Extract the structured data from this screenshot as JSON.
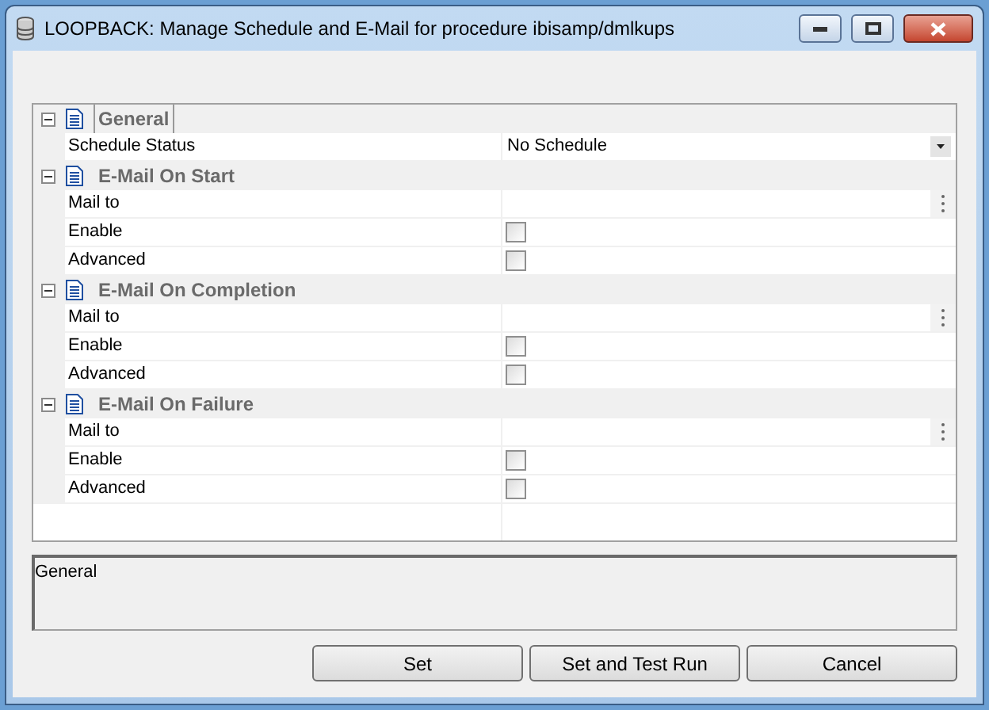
{
  "window": {
    "title": "LOOPBACK: Manage Schedule and E-Mail for procedure ibisamp/dmlkups"
  },
  "sections": [
    {
      "title": "General",
      "expanded": true,
      "selected": true,
      "rows": [
        {
          "kind": "dropdown",
          "label": "Schedule Status",
          "value": "No Schedule"
        }
      ]
    },
    {
      "title": "E-Mail On Start",
      "expanded": true,
      "selected": false,
      "rows": [
        {
          "kind": "ellipsis",
          "label": "Mail to"
        },
        {
          "kind": "checkbox",
          "label": "Enable",
          "checked": false
        },
        {
          "kind": "checkbox",
          "label": "Advanced",
          "checked": false
        }
      ]
    },
    {
      "title": "E-Mail On Completion",
      "expanded": true,
      "selected": false,
      "rows": [
        {
          "kind": "ellipsis",
          "label": "Mail to"
        },
        {
          "kind": "checkbox",
          "label": "Enable",
          "checked": false
        },
        {
          "kind": "checkbox",
          "label": "Advanced",
          "checked": false
        }
      ]
    },
    {
      "title": "E-Mail On Failure",
      "expanded": true,
      "selected": false,
      "rows": [
        {
          "kind": "ellipsis",
          "label": "Mail to"
        },
        {
          "kind": "checkbox",
          "label": "Enable",
          "checked": false
        },
        {
          "kind": "checkbox",
          "label": "Advanced",
          "checked": false
        }
      ]
    }
  ],
  "description": "General",
  "buttons": [
    "Set",
    "Set and Test Run",
    "Cancel"
  ]
}
